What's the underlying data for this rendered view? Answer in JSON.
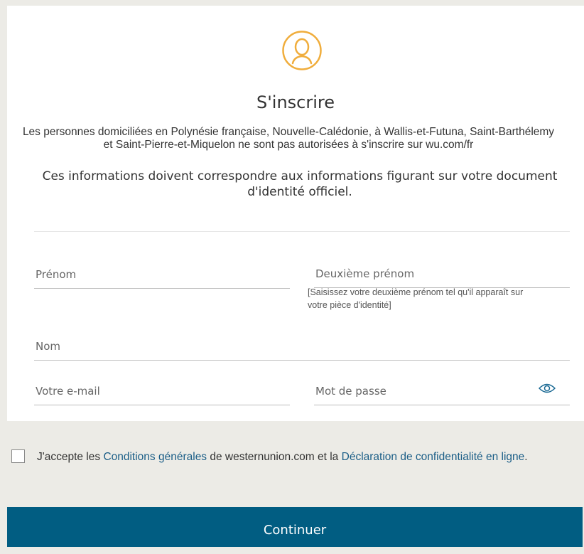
{
  "form": {
    "title": "S'inscrire",
    "notice_line1": "Les personnes domiciliées en Polynésie française, Nouvelle-Calédonie, à Wallis-et-Futuna, Saint-Barthélemy",
    "notice_line2": "et Saint-Pierre-et-Miquelon ne sont pas autorisées à s'inscrire sur wu.com/fr",
    "identity_line1": "Ces informations doivent correspondre aux informations figurant sur votre document",
    "identity_line2": "d'identité officiel.",
    "fields": {
      "first_name": "Prénom",
      "middle_name": "Deuxième prénom",
      "middle_name_hint_line1": "[Saisissez votre deuxième prénom tel qu'il apparaît sur",
      "middle_name_hint_line2": "votre pièce d'identité]",
      "last_name": "Nom",
      "email": "Votre e-mail",
      "password": "Mot de passe"
    },
    "icons": {
      "avatar": "user-avatar-icon",
      "password_toggle": "eye-icon"
    }
  },
  "consent": {
    "prefix": "J'accepte les ",
    "terms_link": "Conditions générales",
    "middle": " de westernunion.com et la ",
    "privacy_link": "Déclaration de confidentialité en ligne",
    "suffix": "."
  },
  "actions": {
    "continue_label": "Continuer"
  },
  "colors": {
    "accent": "#f0ad3c",
    "link": "#1b5e87",
    "button": "#015d82",
    "page_background": "#ecebe6"
  }
}
